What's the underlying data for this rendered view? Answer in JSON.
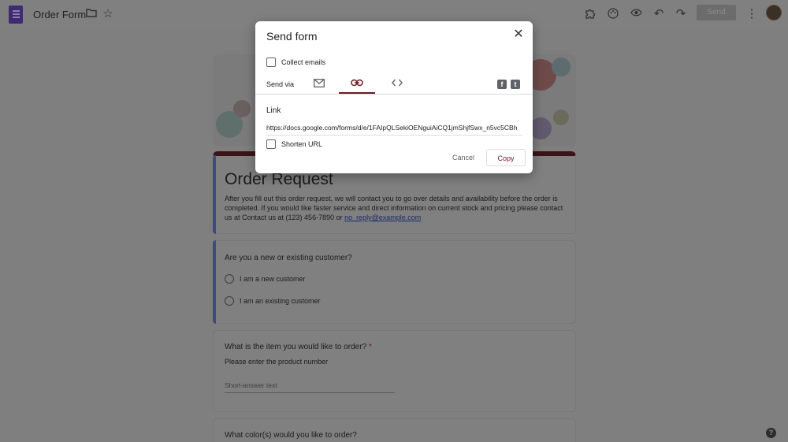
{
  "app": {
    "title": "Order Form",
    "send_label": "Send"
  },
  "icons": {
    "folder": "folder-icon",
    "star": "star-icon",
    "addons": "puzzle-icon",
    "palette": "palette-icon",
    "preview": "eye-icon",
    "undo": "undo-icon",
    "redo": "redo-icon",
    "more": "more-vert-icon",
    "help": "help-icon"
  },
  "form": {
    "title": "Order Request",
    "description": "After you fill out this order request, we will contact you to go over details and availability before the order is completed. If you would like faster service and direct information on current stock and pricing please contact us at Contact us at (123) 456-7890 or ",
    "email": "no_reply@example.com",
    "q1": {
      "title": "Are you a new or existing customer?",
      "options": [
        "I am a new customer",
        "I am an existing customer"
      ]
    },
    "q2": {
      "title": "What is the item you would like to order?",
      "required_mark": "*",
      "helper": "Please enter the product number",
      "placeholder": "Short-answer text"
    },
    "q3": {
      "title": "What color(s) would you like to order?"
    },
    "help_label": "?"
  },
  "dialog": {
    "title": "Send form",
    "collect_emails_label": "Collect emails",
    "send_via_label": "Send via",
    "tabs": [
      "email",
      "link",
      "embed"
    ],
    "active_tab": "link",
    "social": {
      "facebook": "f",
      "twitter": "t"
    },
    "link_label": "Link",
    "url": "https://docs.google.com/forms/d/e/1FAIpQLSekiOENguiAiCQ1jmShjfSwx_n5vc5CBh",
    "shorten_label": "Shorten URL",
    "cancel_label": "Cancel",
    "copy_label": "Copy"
  },
  "colors": {
    "accent": "#6b1a24",
    "overlay": "#808080",
    "header_bar": "#3c1318"
  }
}
